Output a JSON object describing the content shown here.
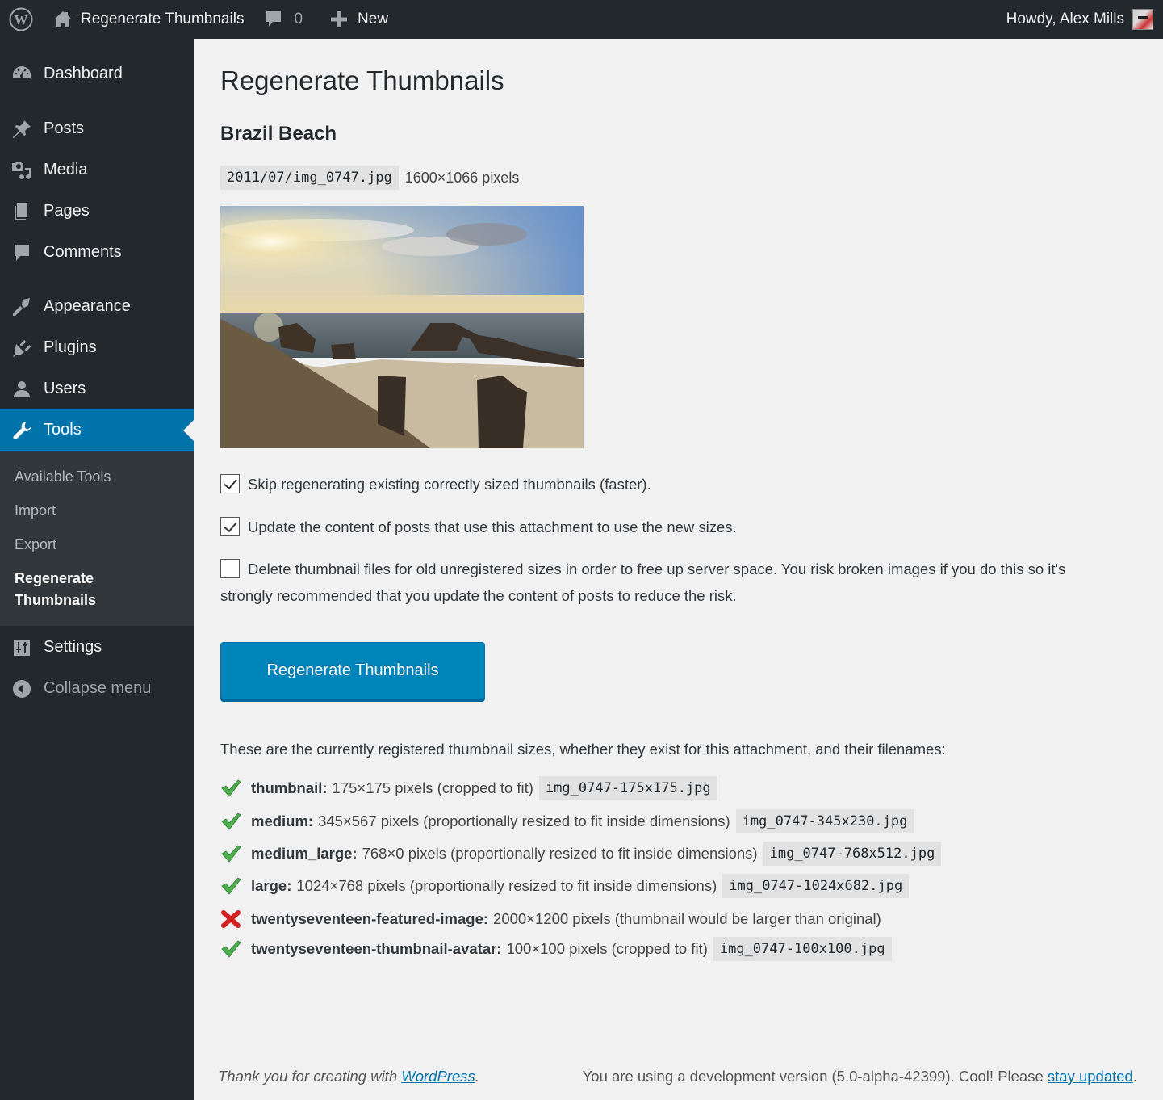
{
  "adminbar": {
    "wp_logo_icon": "wordpress-logo-icon",
    "site_name": "Regenerate Thumbnails",
    "site_icon": "home-icon",
    "comments_icon": "comment-bubble-icon",
    "comments_count": "0",
    "new_icon": "plus-icon",
    "new_label": "New",
    "greeting": "Howdy, Alex Mills",
    "avatar_icon": "user-avatar"
  },
  "sidebar": {
    "items": [
      {
        "label": "Dashboard",
        "icon": "dashboard-gauge-icon"
      },
      {
        "label": "Posts",
        "icon": "pushpin-icon"
      },
      {
        "label": "Media",
        "icon": "media-camera-music-icon"
      },
      {
        "label": "Pages",
        "icon": "pages-icon"
      },
      {
        "label": "Comments",
        "icon": "comment-icon"
      },
      {
        "label": "Appearance",
        "icon": "paintbrush-icon"
      },
      {
        "label": "Plugins",
        "icon": "plug-icon"
      },
      {
        "label": "Users",
        "icon": "user-icon"
      },
      {
        "label": "Tools",
        "icon": "wrench-icon",
        "current": true
      },
      {
        "label": "Settings",
        "icon": "sliders-icon"
      },
      {
        "label": "Collapse menu",
        "icon": "collapse-arrow-icon"
      }
    ],
    "submenu": [
      {
        "label": "Available Tools"
      },
      {
        "label": "Import"
      },
      {
        "label": "Export"
      },
      {
        "label": "Regenerate Thumbnails",
        "current": true
      }
    ]
  },
  "main": {
    "page_title": "Regenerate Thumbnails",
    "attachment_title": "Brazil Beach",
    "file_path": "2011/07/img_0747.jpg",
    "file_dimensions": "1600×1066 pixels",
    "preview_alt": "Brazil Beach sunset with rock arch",
    "options": [
      {
        "label": "Skip regenerating existing correctly sized thumbnails (faster).",
        "checked": true
      },
      {
        "label": "Update the content of posts that use this attachment to use the new sizes.",
        "checked": true
      },
      {
        "label": "Delete thumbnail files for old unregistered sizes in order to free up server space. You risk broken images if you do this so it's strongly recommended that you update the content of posts to reduce the risk.",
        "checked": false
      }
    ],
    "regenerate_button": "Regenerate Thumbnails",
    "sizes_intro": "These are the currently registered thumbnail sizes, whether they exist for this attachment, and their filenames:",
    "sizes": [
      {
        "name": "thumbnail:",
        "desc": "175×175 pixels (cropped to fit)",
        "file": "img_0747-175x175.jpg",
        "status": "ok"
      },
      {
        "name": "medium:",
        "desc": "345×567 pixels (proportionally resized to fit inside dimensions)",
        "file": "img_0747-345x230.jpg",
        "status": "ok"
      },
      {
        "name": "medium_large:",
        "desc": "768×0 pixels (proportionally resized to fit inside dimensions)",
        "file": "img_0747-768x512.jpg",
        "status": "ok"
      },
      {
        "name": "large:",
        "desc": "1024×768 pixels (proportionally resized to fit inside dimensions)",
        "file": "img_0747-1024x682.jpg",
        "status": "ok"
      },
      {
        "name": "twentyseventeen-featured-image:",
        "desc": "2000×1200 pixels (thumbnail would be larger than original)",
        "file": "",
        "status": "error"
      },
      {
        "name": "twentyseventeen-thumbnail-avatar:",
        "desc": "100×100 pixels (cropped to fit)",
        "file": "img_0747-100x100.jpg",
        "status": "ok"
      }
    ]
  },
  "footer": {
    "thanks_prefix": "Thank you for creating with ",
    "thanks_link": "WordPress",
    "thanks_suffix": ".",
    "version_prefix": "You are using a development version (5.0-alpha-42399). Cool! Please ",
    "version_link": "stay updated",
    "version_suffix": "."
  },
  "colors": {
    "adminbar_bg": "#23282d",
    "sidebar_bg": "#23282d",
    "submenu_bg": "#32373c",
    "accent": "#0073aa",
    "button_bg": "#0085ba",
    "page_bg": "#f1f1f1",
    "ok": "#4caf50",
    "error": "#d11"
  }
}
